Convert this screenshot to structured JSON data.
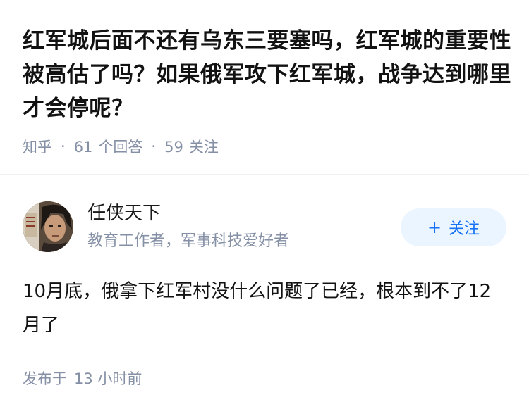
{
  "question": {
    "title": "红军城后面不还有乌东三要塞吗，红军城的重要性被高估了吗？如果俄军攻下红军城，战争达到哪里才会停呢？",
    "source": "知乎",
    "answers_count": "61",
    "answers_label": "个回答",
    "followers_count": "59",
    "followers_label": "关注"
  },
  "author": {
    "name": "任侠天下",
    "bio": "教育工作者，军事科技爱好者",
    "follow_icon": "+",
    "follow_label": "关注"
  },
  "answer": {
    "text": "10月底，俄拿下红军村没什么问题了已经，根本到不了12月了",
    "posted_label": "发布于",
    "posted_time": "13 小时前"
  },
  "colors": {
    "meta_gray": "#8590a6",
    "accent_blue": "#1772f6",
    "follow_bg": "#ebf5ff"
  }
}
